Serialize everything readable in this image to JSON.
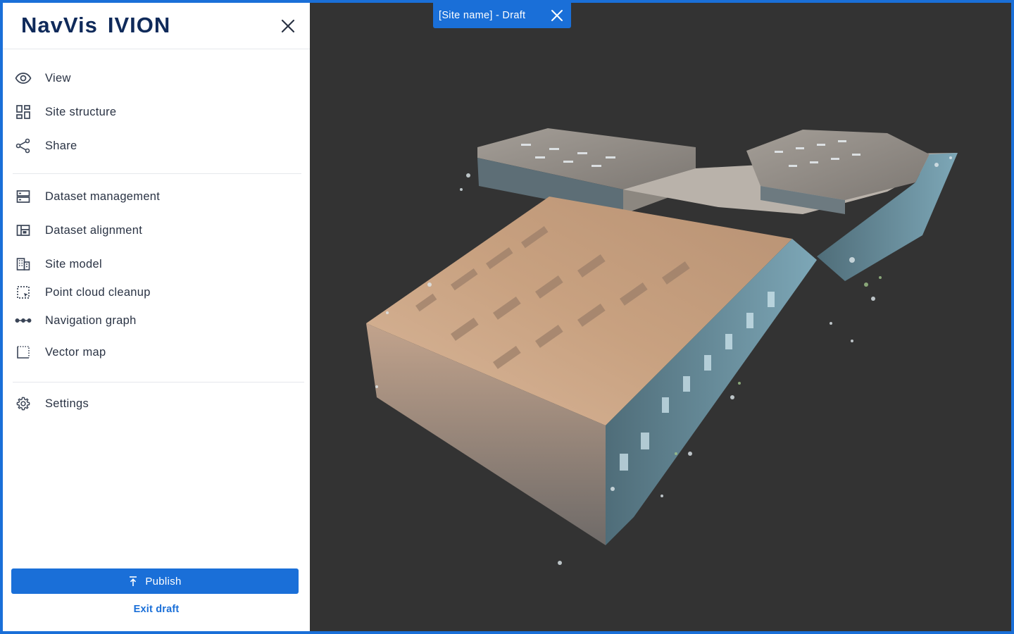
{
  "app": {
    "logo_brand": "NavVis",
    "logo_product": "IVION"
  },
  "sidebar": {
    "groups": [
      {
        "items": [
          {
            "label": "View",
            "icon": "eye-icon"
          },
          {
            "label": "Site structure",
            "icon": "site-structure-icon"
          },
          {
            "label": "Share",
            "icon": "share-icon"
          }
        ]
      },
      {
        "items": [
          {
            "label": "Dataset management",
            "icon": "dataset-management-icon"
          },
          {
            "label": "Dataset alignment",
            "icon": "dataset-alignment-icon"
          },
          {
            "label": "Site model",
            "icon": "site-model-icon"
          },
          {
            "label": "Point cloud cleanup",
            "icon": "point-cloud-cleanup-icon"
          },
          {
            "label": "Navigation graph",
            "icon": "navigation-graph-icon"
          },
          {
            "label": "Vector map",
            "icon": "vector-map-icon"
          }
        ]
      },
      {
        "items": [
          {
            "label": "Settings",
            "icon": "gear-icon"
          }
        ]
      }
    ],
    "publish_label": "Publish",
    "exit_draft_label": "Exit draft"
  },
  "viewport": {
    "draft_tab_label": "[Site name] - Draft",
    "background_color": "#333333"
  },
  "colors": {
    "accent": "#1a6fd8",
    "logo": "#0f2a5a",
    "text": "#2a3344"
  }
}
